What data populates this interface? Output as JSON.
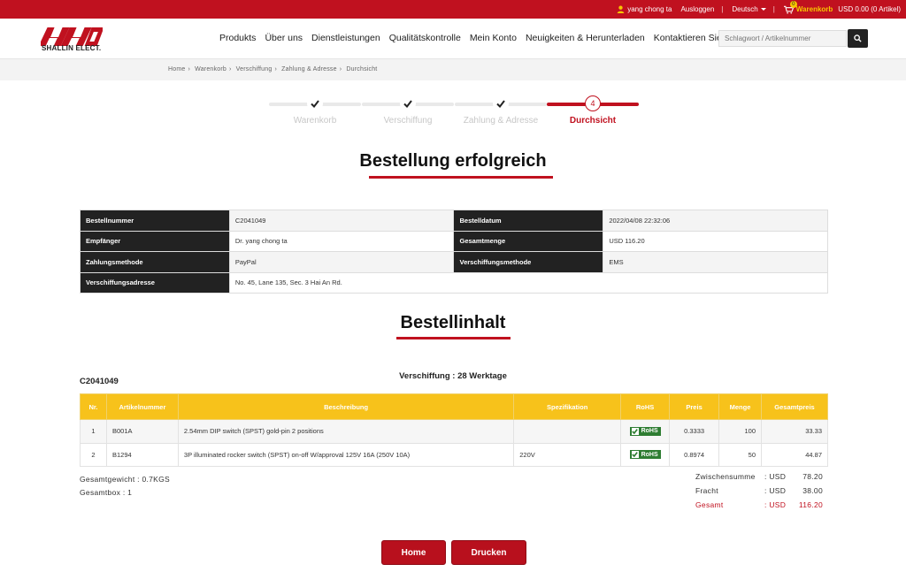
{
  "topbar": {
    "user": "yang chong ta",
    "logout": "Ausloggen",
    "language": "Deutsch",
    "cart_count": "0",
    "cart_label": "Warenkorb",
    "cart_total": "USD 0.00 (0 Artikel)"
  },
  "logo": {
    "mark": "HHQ",
    "company": "SHALLIN ELECT."
  },
  "nav": [
    "Produkts",
    "Über uns",
    "Dienstleistungen",
    "Qualitätskontrolle",
    "Mein Konto",
    "Neuigkeiten & Herunterladen",
    "Kontaktieren Sie uns"
  ],
  "search": {
    "placeholder": "Schlagwort / Artikelnummer"
  },
  "breadcrumb": [
    "Home",
    "Warenkorb",
    "Verschiffung",
    "Zahlung & Adresse",
    "Durchsicht"
  ],
  "steps": [
    {
      "label": "Warenkorb",
      "state": "done"
    },
    {
      "label": "Verschiffung",
      "state": "done"
    },
    {
      "label": "Zahlung & Adresse",
      "state": "done"
    },
    {
      "label": "Durchsicht",
      "state": "active",
      "number": "4"
    }
  ],
  "titles": {
    "success": "Bestellung erfolgreich",
    "content": "Bestellinhalt"
  },
  "order_info": {
    "order_number_label": "Bestellnummer",
    "order_number": "C2041049",
    "order_date_label": "Bestelldatum",
    "order_date": "2022/04/08 22:32:06",
    "recipient_label": "Empfänger",
    "recipient": "Dr. yang chong ta",
    "total_label": "Gesamtmenge",
    "total": "USD 116.20",
    "payment_label": "Zahlungsmethode",
    "payment": "PayPal",
    "shipping_method_label": "Verschiffungsmethode",
    "shipping_method": "EMS",
    "address_label": "Verschiffungsadresse",
    "address": "No. 45, Lane 135, Sec. 3 Hai An Rd."
  },
  "order_id": "C2041049",
  "shipping_days": "Verschiffung : 28 Werktage",
  "items_table": {
    "headers": [
      "Nr.",
      "Artikelnummer",
      "Beschreibung",
      "Spezifikation",
      "RoHS",
      "Preis",
      "Menge",
      "Gesamtpreis"
    ],
    "rows": [
      {
        "nr": "1",
        "part": "B001A",
        "desc": "2.54mm DIP switch (SPST) gold-pin 2 positions",
        "spec": "",
        "rohs": "RoHS",
        "price": "0.3333",
        "qty": "100",
        "total": "33.33"
      },
      {
        "nr": "2",
        "part": "B1294",
        "desc": "3P illuminated rocker switch (SPST) on-off W/approval 125V 16A (250V 10A)",
        "spec": "220V",
        "rohs": "RoHS",
        "price": "0.8974",
        "qty": "50",
        "total": "44.87"
      }
    ]
  },
  "summary_left": {
    "weight": "Gesamtgewicht : 0.7KGS",
    "boxes": "Gesamtbox : 1"
  },
  "summary_right": [
    {
      "label": "Zwischensumme",
      "cur": ": USD",
      "value": "78.20"
    },
    {
      "label": "Fracht",
      "cur": ": USD",
      "value": "38.00"
    },
    {
      "label": "Gesamt",
      "cur": ": USD",
      "value": "116.20"
    }
  ],
  "buttons": {
    "home": "Home",
    "print": "Drucken"
  },
  "colors": {
    "brand_red": "#c0111f",
    "table_header_yellow": "#f7c21b",
    "dark_label": "#222222",
    "link_blue": "#1f5fb5",
    "rohs_green": "#2e7d32"
  }
}
